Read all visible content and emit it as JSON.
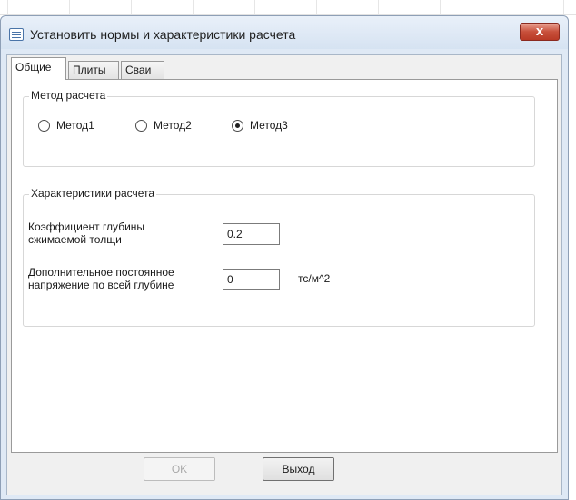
{
  "window": {
    "title": "Установить нормы и характеристики расчета",
    "close_symbol": "x"
  },
  "tabs": [
    {
      "label": "Общие",
      "active": true
    },
    {
      "label": "Плиты",
      "active": false
    },
    {
      "label": "Сваи",
      "active": false
    }
  ],
  "method_group": {
    "title": "Метод расчета",
    "options": [
      {
        "label": "Метод1",
        "checked": false
      },
      {
        "label": "Метод2",
        "checked": false
      },
      {
        "label": "Метод3",
        "checked": true
      }
    ]
  },
  "characteristics_group": {
    "title": "Характеристики расчета",
    "depth_coef": {
      "label_line1": "Коэффициент глубины",
      "label_line2": "сжимаемой толщи",
      "value": "0.2"
    },
    "extra_stress": {
      "label_line1": "Дополнительное постоянное",
      "label_line2": "напряжение по всей глубине",
      "value": "0",
      "unit": "тс/м^2"
    }
  },
  "buttons": {
    "ok": {
      "label": "OK",
      "enabled": false
    },
    "exit": {
      "label": "Выход",
      "enabled": true
    }
  },
  "icons": {
    "app": "dialog-form-icon",
    "close": "close-icon"
  }
}
